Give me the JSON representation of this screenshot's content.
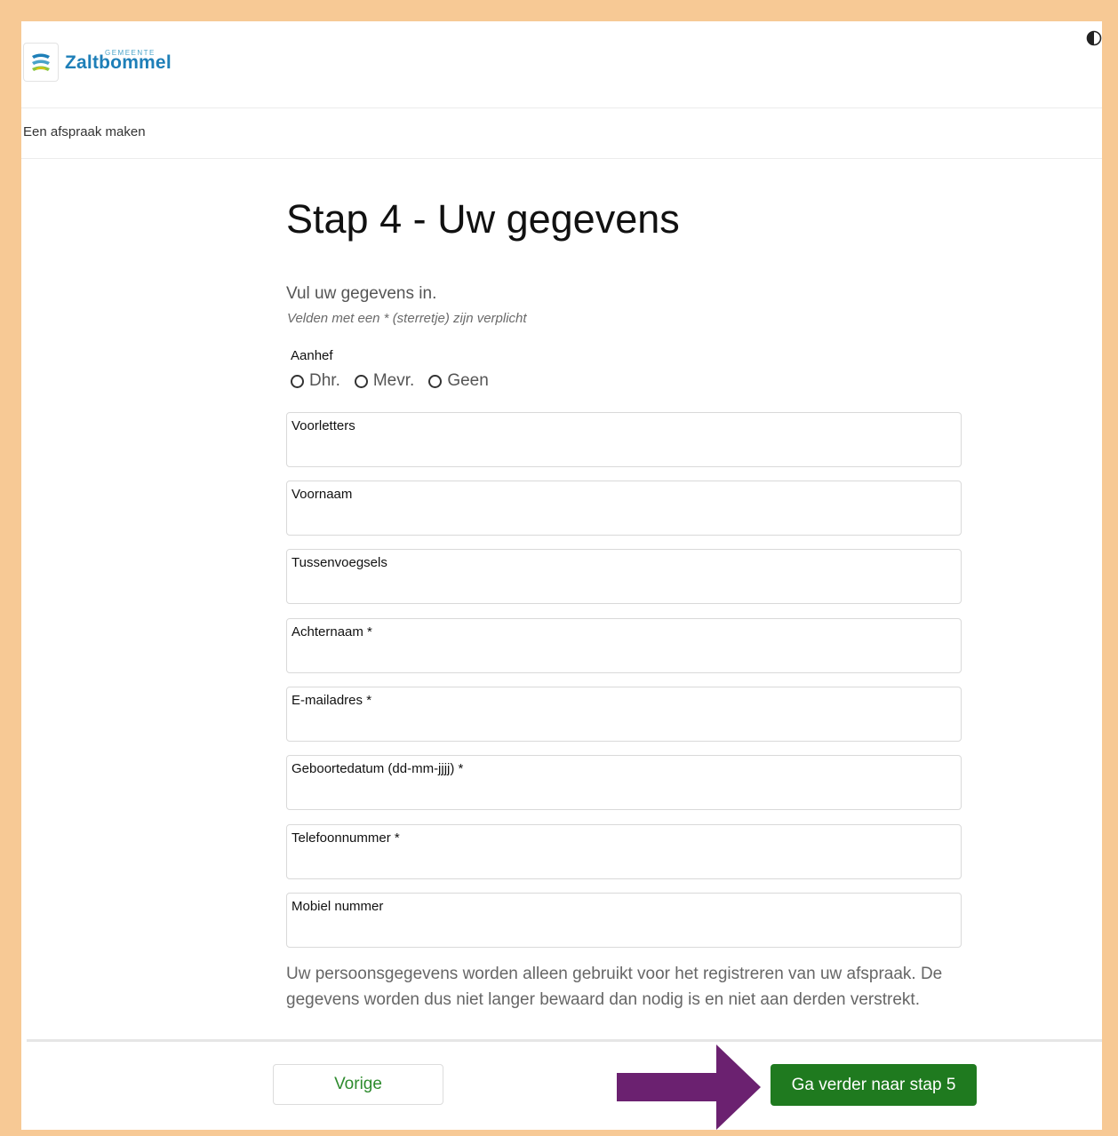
{
  "header": {
    "logo_small": "GEMEENTE",
    "logo_name": "Zaltbommel"
  },
  "subnav": {
    "title": "Een afspraak maken"
  },
  "main": {
    "title": "Stap 4 - Uw gegevens",
    "intro": "Vul uw gegevens in.",
    "required_note": "Velden met een * (sterretje) zijn verplicht",
    "salutation": {
      "label": "Aanhef",
      "options": [
        "Dhr.",
        "Mevr.",
        "Geen"
      ]
    },
    "fields": [
      {
        "label": "Voorletters"
      },
      {
        "label": "Voornaam"
      },
      {
        "label": "Tussenvoegsels"
      },
      {
        "label": "Achternaam *"
      },
      {
        "label": "E-mailadres *"
      },
      {
        "label": "Geboortedatum (dd-mm-jjjj) *"
      },
      {
        "label": "Telefoonnummer *"
      },
      {
        "label": "Mobiel nummer"
      }
    ],
    "privacy": "Uw persoonsgegevens worden alleen gebruikt voor het registreren van uw afspraak. De gegevens worden dus niet langer bewaard dan nodig is en niet aan derden verstrekt."
  },
  "footer": {
    "prev_label": "Vorige",
    "next_label": "Ga verder naar stap 5"
  },
  "colors": {
    "page_border": "#f7c995",
    "primary_green": "#1f7a1f",
    "arrow_purple": "#6b2170",
    "logo_blue": "#1e7fb8"
  },
  "icons": {
    "contrast": "contrast-icon",
    "arrow": "right-arrow-annotation"
  }
}
